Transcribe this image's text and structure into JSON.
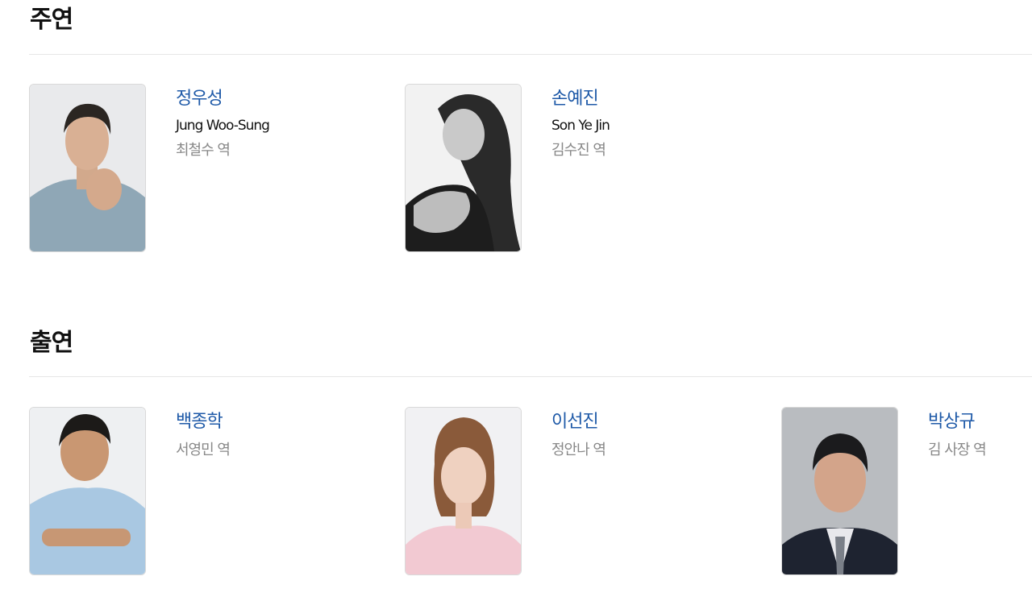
{
  "sections": [
    {
      "title": "주연",
      "cast": [
        {
          "name_ko": "정우성",
          "name_en": "Jung Woo-Sung",
          "role": "최철수 역"
        },
        {
          "name_ko": "손예진",
          "name_en": "Son Ye Jin",
          "role": "김수진 역"
        }
      ]
    },
    {
      "title": "출연",
      "cast": [
        {
          "name_ko": "백종학",
          "role": "서영민 역"
        },
        {
          "name_ko": "이선진",
          "role": "정안나 역"
        },
        {
          "name_ko": "박상규",
          "role": "김 사장 역"
        }
      ]
    }
  ],
  "colors": {
    "name_link": "#1f5aa8",
    "role_text": "#888888",
    "english_name": "#111111",
    "divider": "#e6e6e6"
  }
}
